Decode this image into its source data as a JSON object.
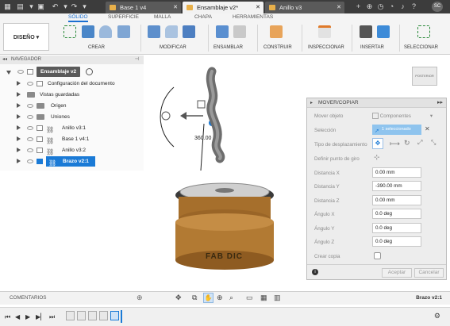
{
  "top_bar": {
    "tabs": [
      {
        "label": "Base 1 v4",
        "active": false
      },
      {
        "label": "Ensamblaje v2*",
        "active": true
      },
      {
        "label": "Anillo v3",
        "active": false
      }
    ],
    "user_initials": "SC"
  },
  "ribbon": {
    "tabs": [
      "SÓLIDO",
      "SUPERFICIE",
      "MALLA",
      "CHAPA",
      "HERRAMIENTAS"
    ],
    "active_tab": "SÓLIDO",
    "design_button": "DISEÑO",
    "groups": [
      "CREAR",
      "MODIFICAR",
      "ENSAMBLAR",
      "CONSTRUIR",
      "INSPECCIONAR",
      "INSERTAR",
      "SELECCIONAR"
    ]
  },
  "navigator": {
    "title": "NAVEGADOR",
    "root": "Ensamblaje v2",
    "items": [
      {
        "label": "Configuración del documento"
      },
      {
        "label": "Vistas guardadas"
      },
      {
        "label": "Origen"
      },
      {
        "label": "Uniones"
      },
      {
        "label": "Anillo v3:1"
      },
      {
        "label": "Base 1 v4:1"
      },
      {
        "label": "Anillo v3:2"
      },
      {
        "label": "Brazo v2:1",
        "selected": true
      }
    ]
  },
  "viewport": {
    "angle_readout": "360.00",
    "model_text": "FAB DIC",
    "viewcube_label": "POSTERIOR"
  },
  "move_panel": {
    "title": "MOVER/COPIAR",
    "rows": [
      {
        "label": "Mover objeto",
        "value": "Componentes"
      },
      {
        "label": "Selección",
        "value": "1 seleccionado"
      },
      {
        "label": "Tipo de desplazamiento",
        "value": ""
      },
      {
        "label": "Definir punto de giro",
        "value": ""
      },
      {
        "label": "Distancia X",
        "value": "0.00 mm"
      },
      {
        "label": "Distancia Y",
        "value": "-390.00 mm"
      },
      {
        "label": "Distancia Z",
        "value": "0.00 mm"
      },
      {
        "label": "Ángulo X",
        "value": "0.0 deg"
      },
      {
        "label": "Ángulo Y",
        "value": "0.0 deg"
      },
      {
        "label": "Ángulo Z",
        "value": "0.0 deg"
      },
      {
        "label": "Crear copia",
        "value": ""
      }
    ],
    "accept": "Aceptar",
    "cancel": "Cancelar"
  },
  "bottom": {
    "comments": "COMENTARIOS",
    "status": "Brazo v2:1"
  },
  "colors": {
    "accent": "#1a7ad6",
    "topbar": "#3c3c3c",
    "bronze": "#b27a33"
  }
}
